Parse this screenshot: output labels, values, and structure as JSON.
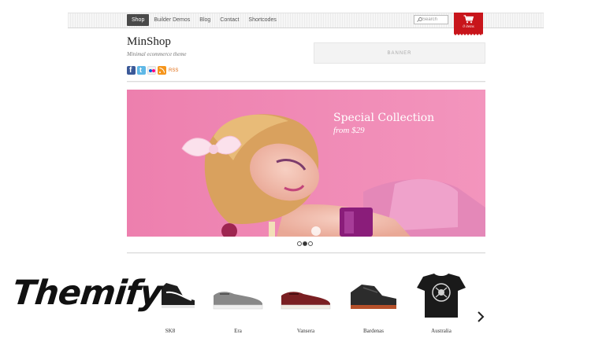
{
  "nav": {
    "items": [
      "Shop",
      "Builder Demos",
      "Blog",
      "Contact",
      "Shortcodes"
    ],
    "active_index": 0
  },
  "search": {
    "placeholder": "Search"
  },
  "cart": {
    "count_label": "0 items",
    "color": "#c8151b"
  },
  "site": {
    "title": "MinShop",
    "tagline": "Minimal ecommerce theme"
  },
  "social": {
    "icons": [
      "facebook-icon",
      "twitter-icon",
      "flickr-icon",
      "rss-icon"
    ],
    "rss_label": "RSS"
  },
  "banner": {
    "label": "BANNER"
  },
  "slider": {
    "title": "Special Collection",
    "subtitle": "from $29",
    "background_color": "#ef86b1",
    "dots": 3,
    "active_dot": 1
  },
  "products": [
    {
      "name": "SK8"
    },
    {
      "name": "Era"
    },
    {
      "name": "Vansera"
    },
    {
      "name": "Bardenas"
    },
    {
      "name": "Australia"
    }
  ],
  "logo": {
    "text": "Themify"
  }
}
